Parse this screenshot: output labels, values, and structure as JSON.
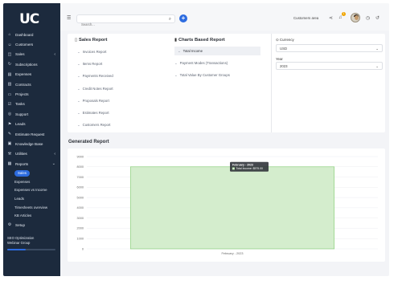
{
  "app": {
    "logo_text": "UC"
  },
  "sidebar": {
    "items": [
      {
        "label": "Dashboard",
        "icon": "home-icon",
        "glyph": "⌂",
        "chevron": ""
      },
      {
        "label": "Customers",
        "icon": "users-icon",
        "glyph": "☺",
        "chevron": ""
      },
      {
        "label": "Sales",
        "icon": "cart-icon",
        "glyph": "◫",
        "chevron": "‹"
      },
      {
        "label": "Subscriptions",
        "icon": "refresh-icon",
        "glyph": "↻",
        "chevron": ""
      },
      {
        "label": "Expenses",
        "icon": "receipt-icon",
        "glyph": "▤",
        "chevron": ""
      },
      {
        "label": "Contracts",
        "icon": "contract-icon",
        "glyph": "▥",
        "chevron": ""
      },
      {
        "label": "Projects",
        "icon": "folder-icon",
        "glyph": "▭",
        "chevron": ""
      },
      {
        "label": "Tasks",
        "icon": "tasks-icon",
        "glyph": "☑",
        "chevron": ""
      },
      {
        "label": "Support",
        "icon": "support-icon",
        "glyph": "◎",
        "chevron": ""
      },
      {
        "label": "Leads",
        "icon": "leads-icon",
        "glyph": "⚑",
        "chevron": ""
      },
      {
        "label": "Estimate Request",
        "icon": "request-icon",
        "glyph": "✎",
        "chevron": ""
      },
      {
        "label": "Knowledge Base",
        "icon": "book-icon",
        "glyph": "▣",
        "chevron": ""
      },
      {
        "label": "Utilities",
        "icon": "tools-icon",
        "glyph": "⚒",
        "chevron": "‹"
      },
      {
        "label": "Reports",
        "icon": "chart-icon",
        "glyph": "▦",
        "chevron": "⌄"
      }
    ],
    "report_subitems": [
      "Sales",
      "Expenses",
      "Expenses vs Income",
      "Leads",
      "Timesheets overview",
      "KB Articles"
    ],
    "setup_label": "Setup",
    "setup_glyph": "⚙",
    "seo_line1": "SEO Optimization",
    "seo_line2": "Webinar Group",
    "seo_progress": 0.38
  },
  "topbar": {
    "search_placeholder": "Search...",
    "customers_area": "Customers area"
  },
  "reports": {
    "sales_title": "Sales Report",
    "sales_links": [
      "Invoices Report",
      "Items Report",
      "Payments Received",
      "Credit Notes Report",
      "Proposals Report",
      "Estimates Report",
      "Customers Report"
    ],
    "charts_title": "Charts Based Report",
    "chart_links": [
      "Total Income",
      "Payment Modes (Transactions)",
      "Total Value By Customer Groups"
    ],
    "currency_label": "Currency",
    "currency_value": "USD",
    "year_label": "Year",
    "year_value": "2023"
  },
  "generated": {
    "title": "Generated Report"
  },
  "colors": {
    "sidebar": "#1c2a3d",
    "accent": "#2d6ce0",
    "bar_fill": "#d4edcd",
    "bar_stroke": "#8ccf7e"
  },
  "chart_data": {
    "type": "bar",
    "categories": [
      "February - 2023"
    ],
    "series": [
      {
        "values": [
          8000
        ]
      }
    ],
    "ylim": [
      0,
      9000
    ],
    "yticks": [
      "0",
      "1000",
      "2000",
      "3000",
      "4000",
      "5000",
      "6000",
      "7000",
      "8000",
      "9000"
    ],
    "tooltip": {
      "title": "February - 2023",
      "line": "Total Income: $575.00"
    },
    "grid": true
  }
}
